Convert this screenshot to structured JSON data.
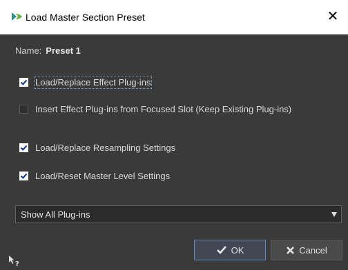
{
  "window": {
    "title": "Load Master Section Preset",
    "close_icon": "close-icon",
    "app_icon": "wavelab-logo-icon"
  },
  "name_row": {
    "label": "Name:",
    "value": "Preset 1"
  },
  "options": [
    {
      "label": "Load/Replace Effect Plug-ins",
      "checked": true
    },
    {
      "label": "Insert Effect Plug-ins from Focused Slot (Keep Existing Plug-ins)",
      "checked": false
    },
    {
      "label": "Load/Replace Resampling Settings",
      "checked": true
    },
    {
      "label": "Load/Reset Master Level Settings",
      "checked": true
    }
  ],
  "filter": {
    "selected": "Show All Plug-ins"
  },
  "buttons": {
    "ok": "OK",
    "cancel": "Cancel"
  },
  "colors": {
    "accent": "#6c86b4",
    "background": "#3a3a3a"
  }
}
